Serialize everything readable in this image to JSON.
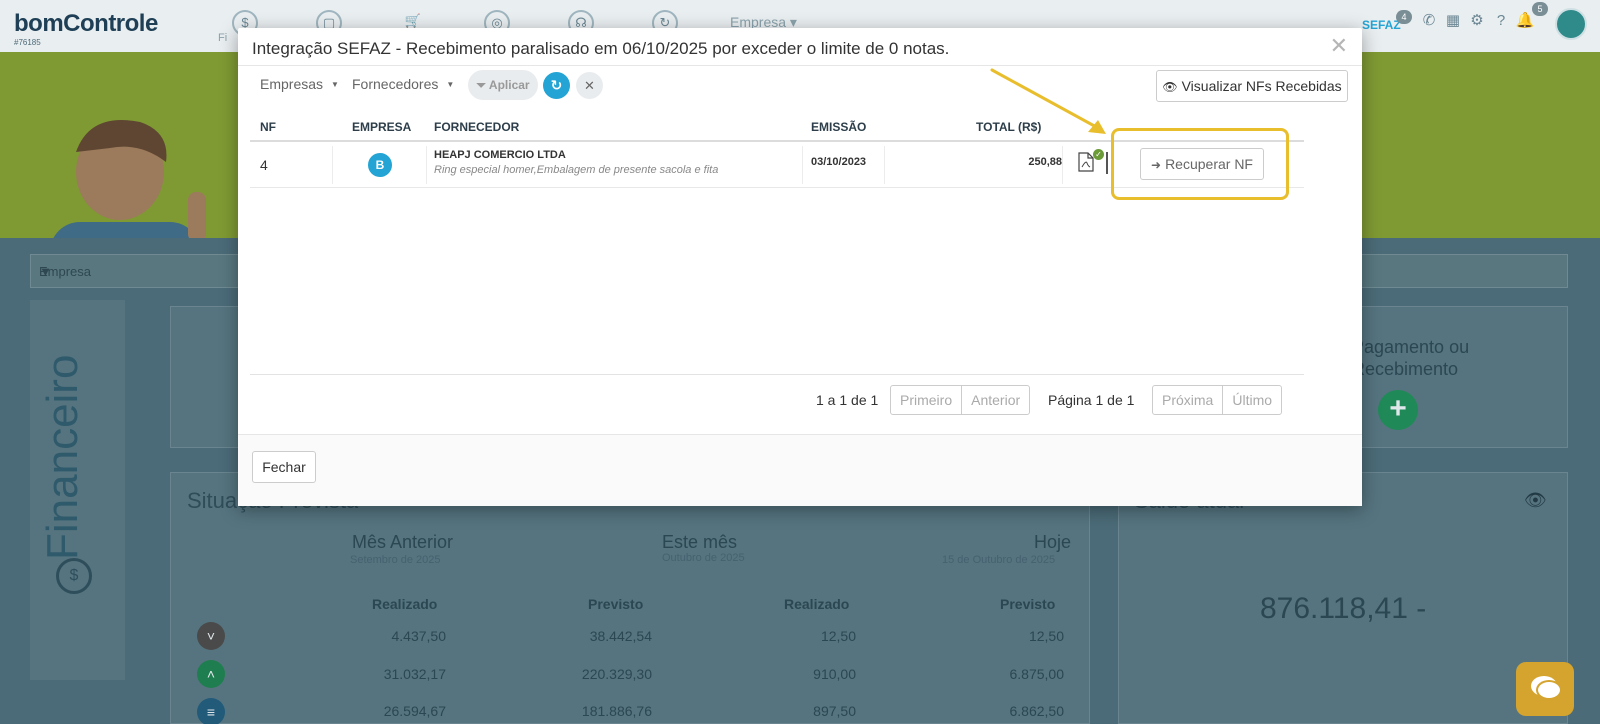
{
  "app": {
    "logo": "bomControle",
    "logo_sub": "#76185",
    "top_menu_company": "Empresa",
    "top_menu_fi": "Fi",
    "sefaz_label": "SEFAZ",
    "sefaz_badge": "4",
    "notif_badge": "5"
  },
  "background": {
    "company_select": "Empresa",
    "side_label": "Financeiro",
    "payment_card": "Pagamento ou\nRecebimento",
    "situacao_title": "Situação Prevista",
    "saldo_title": "Saldo atual",
    "periods": [
      {
        "label": "Mês Anterior",
        "sub": "Setembro de 2025"
      },
      {
        "label": "Este mês",
        "sub": "Outubro de 2025"
      },
      {
        "label": "Hoje",
        "sub": "15 de Outubro de 2025"
      }
    ],
    "col_heads": [
      "Realizado",
      "Previsto",
      "Realizado",
      "Previsto"
    ],
    "rows": [
      [
        "4.437,50",
        "38.442,54",
        "12,50",
        "12,50"
      ],
      [
        "31.032,17",
        "220.329,30",
        "910,00",
        "6.875,00"
      ],
      [
        "26.594,67",
        "181.886,76",
        "897,50",
        "6.862,50"
      ]
    ],
    "saldo_value": "876.118,41 -"
  },
  "modal": {
    "title": "Integração SEFAZ - Recebimento paralisado em 06/10/2025 por exceder o limite de 0 notas.",
    "close_icon": "times-icon",
    "filters": {
      "empresas": "Empresas",
      "fornecedores": "Fornecedores",
      "apply": "Aplicar",
      "view_received": "Visualizar NFs Recebidas"
    },
    "columns": {
      "nf": "NF",
      "empresa": "EMPRESA",
      "fornecedor": "FORNECEDOR",
      "emissao": "EMISSÃO",
      "total": "TOTAL (R$)"
    },
    "rows": [
      {
        "nf": "4",
        "empresa": "B",
        "fornecedor": "HEAPJ COMERCIO LTDA",
        "descricao": "Ring especial homer,Embalagem de presente sacola e fita",
        "emissao": "03/10/2023",
        "total": "250,88",
        "action": "Recuperar NF"
      }
    ],
    "pagination": {
      "range": "1 a 1 de 1",
      "first": "Primeiro",
      "prev": "Anterior",
      "page": "Página 1 de 1",
      "next": "Próxima",
      "last": "Último"
    },
    "footer": {
      "close": "Fechar"
    }
  },
  "colors": {
    "accent": "#23a4d4",
    "highlight": "#e9be2d",
    "overlay": "#3d5d6a",
    "hero": "#7f9a33"
  }
}
